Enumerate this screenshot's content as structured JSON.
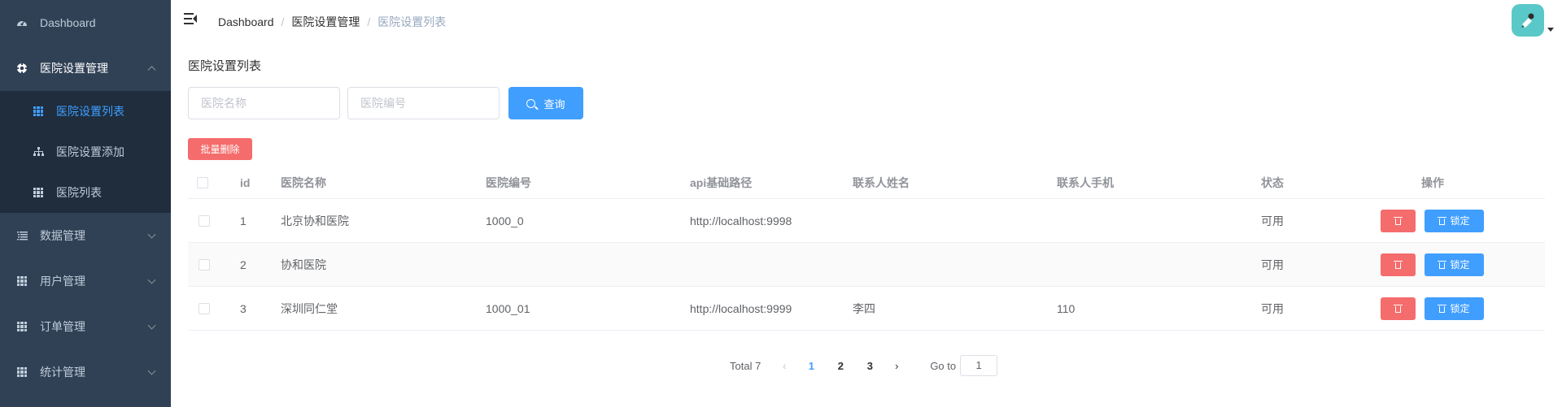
{
  "sidebar": {
    "items": [
      {
        "label": "Dashboard",
        "icon": "dashboard-icon"
      },
      {
        "label": "医院设置管理",
        "icon": "settings-gear-icon",
        "expanded": true
      },
      {
        "label": "数据管理",
        "icon": "list-icon"
      },
      {
        "label": "用户管理",
        "icon": "table-icon"
      },
      {
        "label": "订单管理",
        "icon": "table-icon"
      },
      {
        "label": "统计管理",
        "icon": "table-icon"
      }
    ],
    "submenu": [
      {
        "label": "医院设置列表",
        "icon": "table-icon",
        "active": true
      },
      {
        "label": "医院设置添加",
        "icon": "tree-icon"
      },
      {
        "label": "医院列表",
        "icon": "table-icon"
      }
    ]
  },
  "breadcrumb": [
    "Dashboard",
    "医院设置管理",
    "医院设置列表"
  ],
  "page_title": "医院设置列表",
  "search": {
    "name_placeholder": "医院名称",
    "code_placeholder": "医院编号",
    "query_label": "查询"
  },
  "batch_delete_label": "批量删除",
  "table": {
    "columns": [
      "id",
      "医院名称",
      "医院编号",
      "api基础路径",
      "联系人姓名",
      "联系人手机",
      "状态",
      "操作"
    ],
    "rows": [
      {
        "id": "1",
        "name": "北京协和医院",
        "code": "1000_0",
        "api": "http://localhost:9998",
        "contact": "",
        "phone": "",
        "status": "可用"
      },
      {
        "id": "2",
        "name": "协和医院",
        "code": "",
        "api": "",
        "contact": "",
        "phone": "",
        "status": "可用"
      },
      {
        "id": "3",
        "name": "深圳同仁堂",
        "code": "1000_01",
        "api": "http://localhost:9999",
        "contact": "李四",
        "phone": "110",
        "status": "可用"
      }
    ],
    "lock_label": "锁定"
  },
  "pagination": {
    "total_label": "Total 7",
    "pages": [
      "1",
      "2",
      "3"
    ],
    "current": "1",
    "goto_label": "Go to",
    "goto_value": "1"
  },
  "colors": {
    "sidebar_bg": "#304156",
    "submenu_bg": "#1f2d3d",
    "primary": "#409eff",
    "danger": "#f56c6c",
    "avatar_bg": "#5ac8c8"
  }
}
